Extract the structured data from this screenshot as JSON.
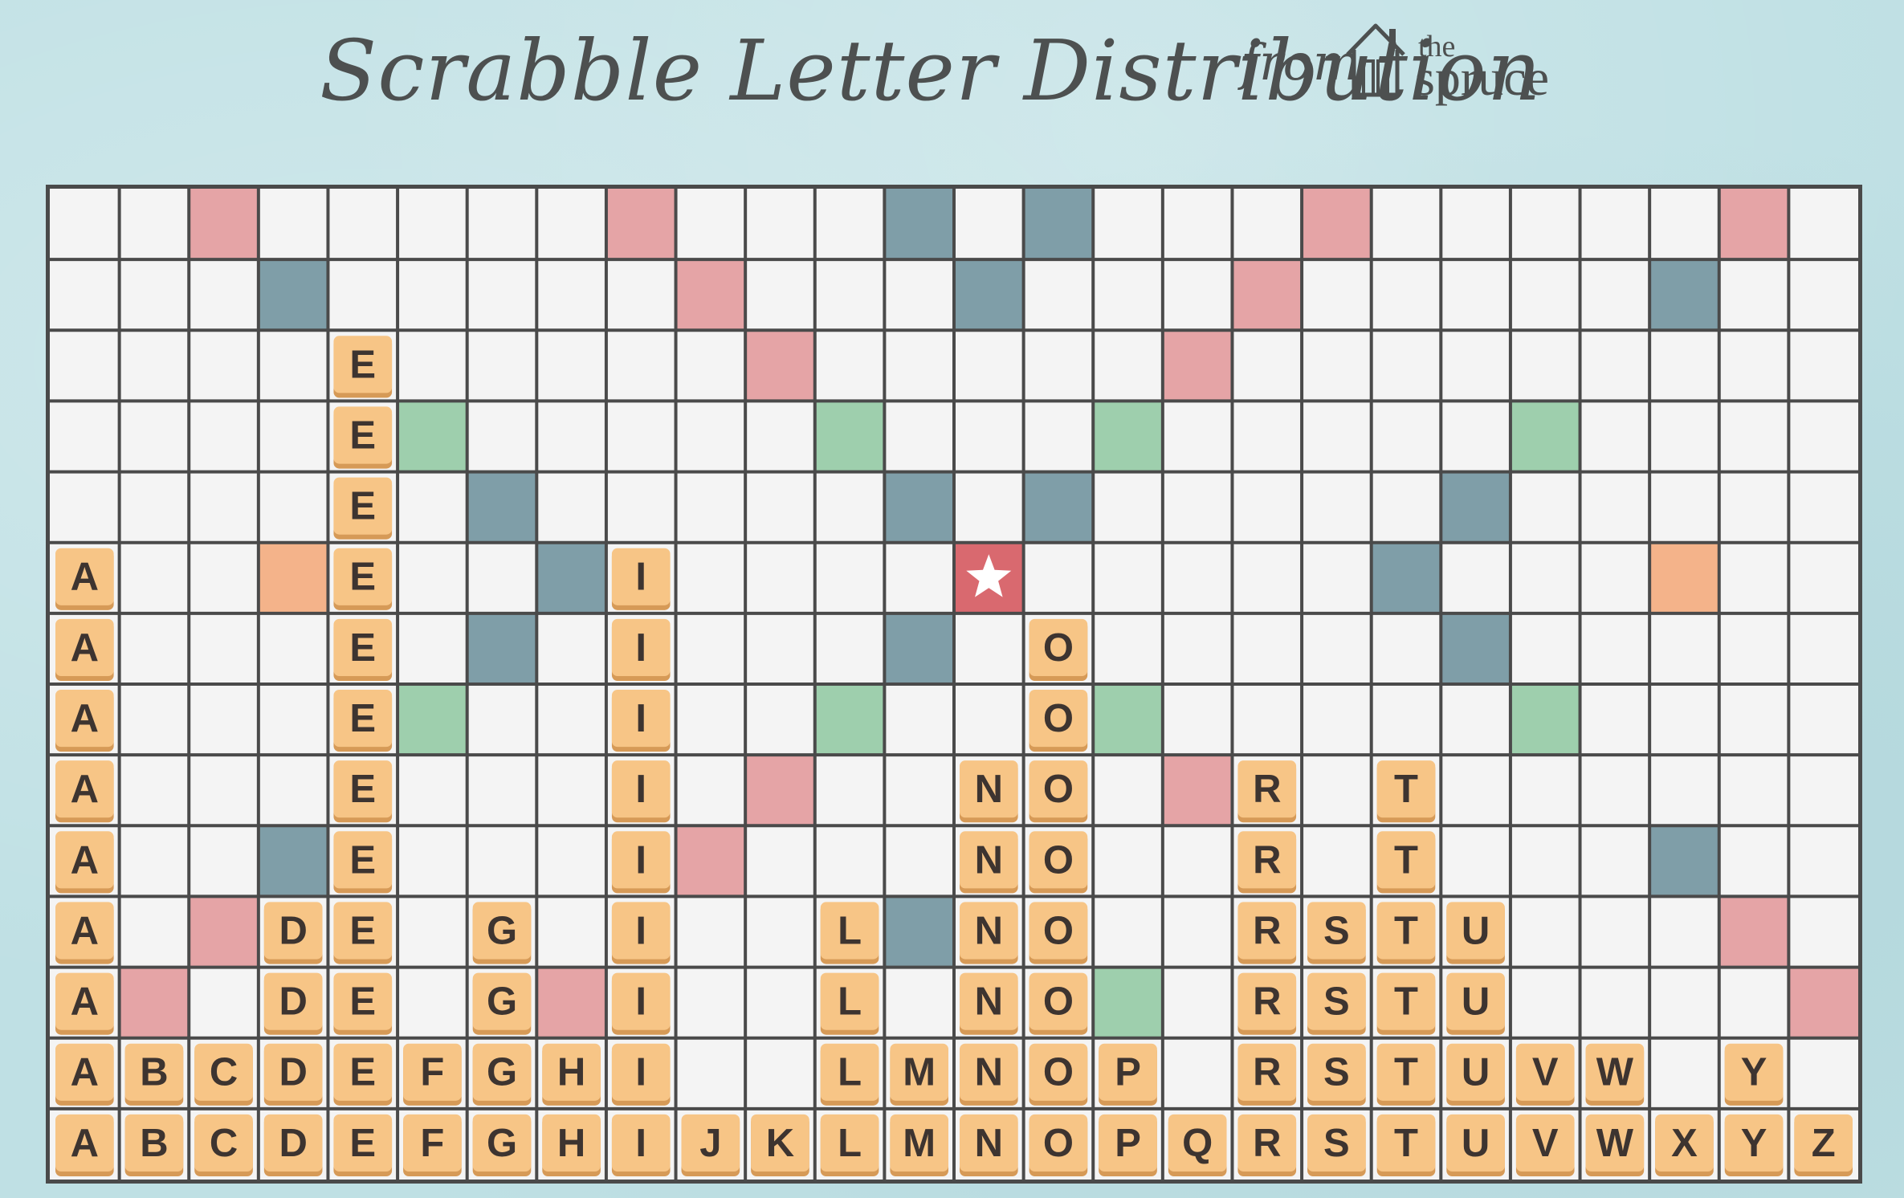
{
  "header": {
    "title": "Scrabble Letter Distribution",
    "from_word": "from",
    "logo_the": "the",
    "logo_spruce": "spruce"
  },
  "board": {
    "rows": 14,
    "cols": 26,
    "colors": {
      "grid_line": "#4a4a4a",
      "cell": "#f4f4f4",
      "pink": "#e5a4a6",
      "blue": "#7f9ea8",
      "green": "#9ecfad",
      "orange": "#f4b38a",
      "star_bg": "#d9696f",
      "star": "#ffffff",
      "tile": "#f7c586",
      "tile_edge": "#d69a57",
      "tile_text": "#3d3430"
    },
    "special_cells": [
      {
        "row": 0,
        "col": 2,
        "type": "pink"
      },
      {
        "row": 0,
        "col": 8,
        "type": "pink"
      },
      {
        "row": 0,
        "col": 12,
        "type": "blue"
      },
      {
        "row": 0,
        "col": 14,
        "type": "blue"
      },
      {
        "row": 0,
        "col": 18,
        "type": "pink"
      },
      {
        "row": 0,
        "col": 24,
        "type": "pink"
      },
      {
        "row": 1,
        "col": 3,
        "type": "blue"
      },
      {
        "row": 1,
        "col": 9,
        "type": "pink"
      },
      {
        "row": 1,
        "col": 13,
        "type": "blue"
      },
      {
        "row": 1,
        "col": 17,
        "type": "pink"
      },
      {
        "row": 1,
        "col": 23,
        "type": "blue"
      },
      {
        "row": 2,
        "col": 10,
        "type": "pink"
      },
      {
        "row": 2,
        "col": 16,
        "type": "pink"
      },
      {
        "row": 3,
        "col": 5,
        "type": "green"
      },
      {
        "row": 3,
        "col": 11,
        "type": "green"
      },
      {
        "row": 3,
        "col": 15,
        "type": "green"
      },
      {
        "row": 3,
        "col": 21,
        "type": "green"
      },
      {
        "row": 4,
        "col": 6,
        "type": "blue"
      },
      {
        "row": 4,
        "col": 12,
        "type": "blue"
      },
      {
        "row": 4,
        "col": 14,
        "type": "blue"
      },
      {
        "row": 4,
        "col": 20,
        "type": "blue"
      },
      {
        "row": 5,
        "col": 3,
        "type": "orange"
      },
      {
        "row": 5,
        "col": 7,
        "type": "blue"
      },
      {
        "row": 5,
        "col": 13,
        "type": "star"
      },
      {
        "row": 5,
        "col": 19,
        "type": "blue"
      },
      {
        "row": 5,
        "col": 23,
        "type": "orange"
      },
      {
        "row": 6,
        "col": 6,
        "type": "blue"
      },
      {
        "row": 6,
        "col": 12,
        "type": "blue"
      },
      {
        "row": 6,
        "col": 20,
        "type": "blue"
      },
      {
        "row": 7,
        "col": 5,
        "type": "green"
      },
      {
        "row": 7,
        "col": 11,
        "type": "green"
      },
      {
        "row": 7,
        "col": 15,
        "type": "green"
      },
      {
        "row": 7,
        "col": 21,
        "type": "green"
      },
      {
        "row": 8,
        "col": 10,
        "type": "pink"
      },
      {
        "row": 8,
        "col": 16,
        "type": "pink"
      },
      {
        "row": 9,
        "col": 3,
        "type": "blue"
      },
      {
        "row": 9,
        "col": 9,
        "type": "pink"
      },
      {
        "row": 9,
        "col": 23,
        "type": "blue"
      },
      {
        "row": 10,
        "col": 2,
        "type": "pink"
      },
      {
        "row": 10,
        "col": 12,
        "type": "blue"
      },
      {
        "row": 10,
        "col": 24,
        "type": "pink"
      },
      {
        "row": 11,
        "col": 1,
        "type": "pink"
      },
      {
        "row": 11,
        "col": 7,
        "type": "pink"
      },
      {
        "row": 11,
        "col": 15,
        "type": "green"
      },
      {
        "row": 11,
        "col": 25,
        "type": "pink"
      }
    ],
    "tiles": [
      {
        "row": 2,
        "col": 4,
        "letter": "E"
      },
      {
        "row": 3,
        "col": 4,
        "letter": "E"
      },
      {
        "row": 4,
        "col": 4,
        "letter": "E"
      },
      {
        "row": 5,
        "col": 0,
        "letter": "A"
      },
      {
        "row": 5,
        "col": 4,
        "letter": "E"
      },
      {
        "row": 5,
        "col": 8,
        "letter": "I"
      },
      {
        "row": 6,
        "col": 0,
        "letter": "A"
      },
      {
        "row": 6,
        "col": 4,
        "letter": "E"
      },
      {
        "row": 6,
        "col": 8,
        "letter": "I"
      },
      {
        "row": 6,
        "col": 14,
        "letter": "O"
      },
      {
        "row": 7,
        "col": 0,
        "letter": "A"
      },
      {
        "row": 7,
        "col": 4,
        "letter": "E"
      },
      {
        "row": 7,
        "col": 8,
        "letter": "I"
      },
      {
        "row": 7,
        "col": 14,
        "letter": "O"
      },
      {
        "row": 8,
        "col": 0,
        "letter": "A"
      },
      {
        "row": 8,
        "col": 4,
        "letter": "E"
      },
      {
        "row": 8,
        "col": 8,
        "letter": "I"
      },
      {
        "row": 8,
        "col": 13,
        "letter": "N"
      },
      {
        "row": 8,
        "col": 14,
        "letter": "O"
      },
      {
        "row": 8,
        "col": 17,
        "letter": "R"
      },
      {
        "row": 8,
        "col": 19,
        "letter": "T"
      },
      {
        "row": 9,
        "col": 0,
        "letter": "A"
      },
      {
        "row": 9,
        "col": 4,
        "letter": "E"
      },
      {
        "row": 9,
        "col": 8,
        "letter": "I"
      },
      {
        "row": 9,
        "col": 13,
        "letter": "N"
      },
      {
        "row": 9,
        "col": 14,
        "letter": "O"
      },
      {
        "row": 9,
        "col": 17,
        "letter": "R"
      },
      {
        "row": 9,
        "col": 19,
        "letter": "T"
      },
      {
        "row": 10,
        "col": 0,
        "letter": "A"
      },
      {
        "row": 10,
        "col": 3,
        "letter": "D"
      },
      {
        "row": 10,
        "col": 4,
        "letter": "E"
      },
      {
        "row": 10,
        "col": 6,
        "letter": "G"
      },
      {
        "row": 10,
        "col": 8,
        "letter": "I"
      },
      {
        "row": 10,
        "col": 11,
        "letter": "L"
      },
      {
        "row": 10,
        "col": 13,
        "letter": "N"
      },
      {
        "row": 10,
        "col": 14,
        "letter": "O"
      },
      {
        "row": 10,
        "col": 17,
        "letter": "R"
      },
      {
        "row": 10,
        "col": 18,
        "letter": "S"
      },
      {
        "row": 10,
        "col": 19,
        "letter": "T"
      },
      {
        "row": 10,
        "col": 20,
        "letter": "U"
      },
      {
        "row": 11,
        "col": 0,
        "letter": "A"
      },
      {
        "row": 11,
        "col": 3,
        "letter": "D"
      },
      {
        "row": 11,
        "col": 4,
        "letter": "E"
      },
      {
        "row": 11,
        "col": 6,
        "letter": "G"
      },
      {
        "row": 11,
        "col": 8,
        "letter": "I"
      },
      {
        "row": 11,
        "col": 11,
        "letter": "L"
      },
      {
        "row": 11,
        "col": 13,
        "letter": "N"
      },
      {
        "row": 11,
        "col": 14,
        "letter": "O"
      },
      {
        "row": 11,
        "col": 17,
        "letter": "R"
      },
      {
        "row": 11,
        "col": 18,
        "letter": "S"
      },
      {
        "row": 11,
        "col": 19,
        "letter": "T"
      },
      {
        "row": 11,
        "col": 20,
        "letter": "U"
      },
      {
        "row": 12,
        "col": 0,
        "letter": "A"
      },
      {
        "row": 12,
        "col": 1,
        "letter": "B"
      },
      {
        "row": 12,
        "col": 2,
        "letter": "C"
      },
      {
        "row": 12,
        "col": 3,
        "letter": "D"
      },
      {
        "row": 12,
        "col": 4,
        "letter": "E"
      },
      {
        "row": 12,
        "col": 5,
        "letter": "F"
      },
      {
        "row": 12,
        "col": 6,
        "letter": "G"
      },
      {
        "row": 12,
        "col": 7,
        "letter": "H"
      },
      {
        "row": 12,
        "col": 8,
        "letter": "I"
      },
      {
        "row": 12,
        "col": 11,
        "letter": "L"
      },
      {
        "row": 12,
        "col": 12,
        "letter": "M"
      },
      {
        "row": 12,
        "col": 13,
        "letter": "N"
      },
      {
        "row": 12,
        "col": 14,
        "letter": "O"
      },
      {
        "row": 12,
        "col": 15,
        "letter": "P"
      },
      {
        "row": 12,
        "col": 17,
        "letter": "R"
      },
      {
        "row": 12,
        "col": 18,
        "letter": "S"
      },
      {
        "row": 12,
        "col": 19,
        "letter": "T"
      },
      {
        "row": 12,
        "col": 20,
        "letter": "U"
      },
      {
        "row": 12,
        "col": 21,
        "letter": "V"
      },
      {
        "row": 12,
        "col": 22,
        "letter": "W"
      },
      {
        "row": 12,
        "col": 24,
        "letter": "Y"
      },
      {
        "row": 13,
        "col": 0,
        "letter": "A"
      },
      {
        "row": 13,
        "col": 1,
        "letter": "B"
      },
      {
        "row": 13,
        "col": 2,
        "letter": "C"
      },
      {
        "row": 13,
        "col": 3,
        "letter": "D"
      },
      {
        "row": 13,
        "col": 4,
        "letter": "E"
      },
      {
        "row": 13,
        "col": 5,
        "letter": "F"
      },
      {
        "row": 13,
        "col": 6,
        "letter": "G"
      },
      {
        "row": 13,
        "col": 7,
        "letter": "H"
      },
      {
        "row": 13,
        "col": 8,
        "letter": "I"
      },
      {
        "row": 13,
        "col": 9,
        "letter": "J"
      },
      {
        "row": 13,
        "col": 10,
        "letter": "K"
      },
      {
        "row": 13,
        "col": 11,
        "letter": "L"
      },
      {
        "row": 13,
        "col": 12,
        "letter": "M"
      },
      {
        "row": 13,
        "col": 13,
        "letter": "N"
      },
      {
        "row": 13,
        "col": 14,
        "letter": "O"
      },
      {
        "row": 13,
        "col": 15,
        "letter": "P"
      },
      {
        "row": 13,
        "col": 16,
        "letter": "Q"
      },
      {
        "row": 13,
        "col": 17,
        "letter": "R"
      },
      {
        "row": 13,
        "col": 18,
        "letter": "S"
      },
      {
        "row": 13,
        "col": 19,
        "letter": "T"
      },
      {
        "row": 13,
        "col": 20,
        "letter": "U"
      },
      {
        "row": 13,
        "col": 21,
        "letter": "V"
      },
      {
        "row": 13,
        "col": 22,
        "letter": "W"
      },
      {
        "row": 13,
        "col": 23,
        "letter": "X"
      },
      {
        "row": 13,
        "col": 24,
        "letter": "Y"
      },
      {
        "row": 13,
        "col": 25,
        "letter": "Z"
      }
    ]
  }
}
